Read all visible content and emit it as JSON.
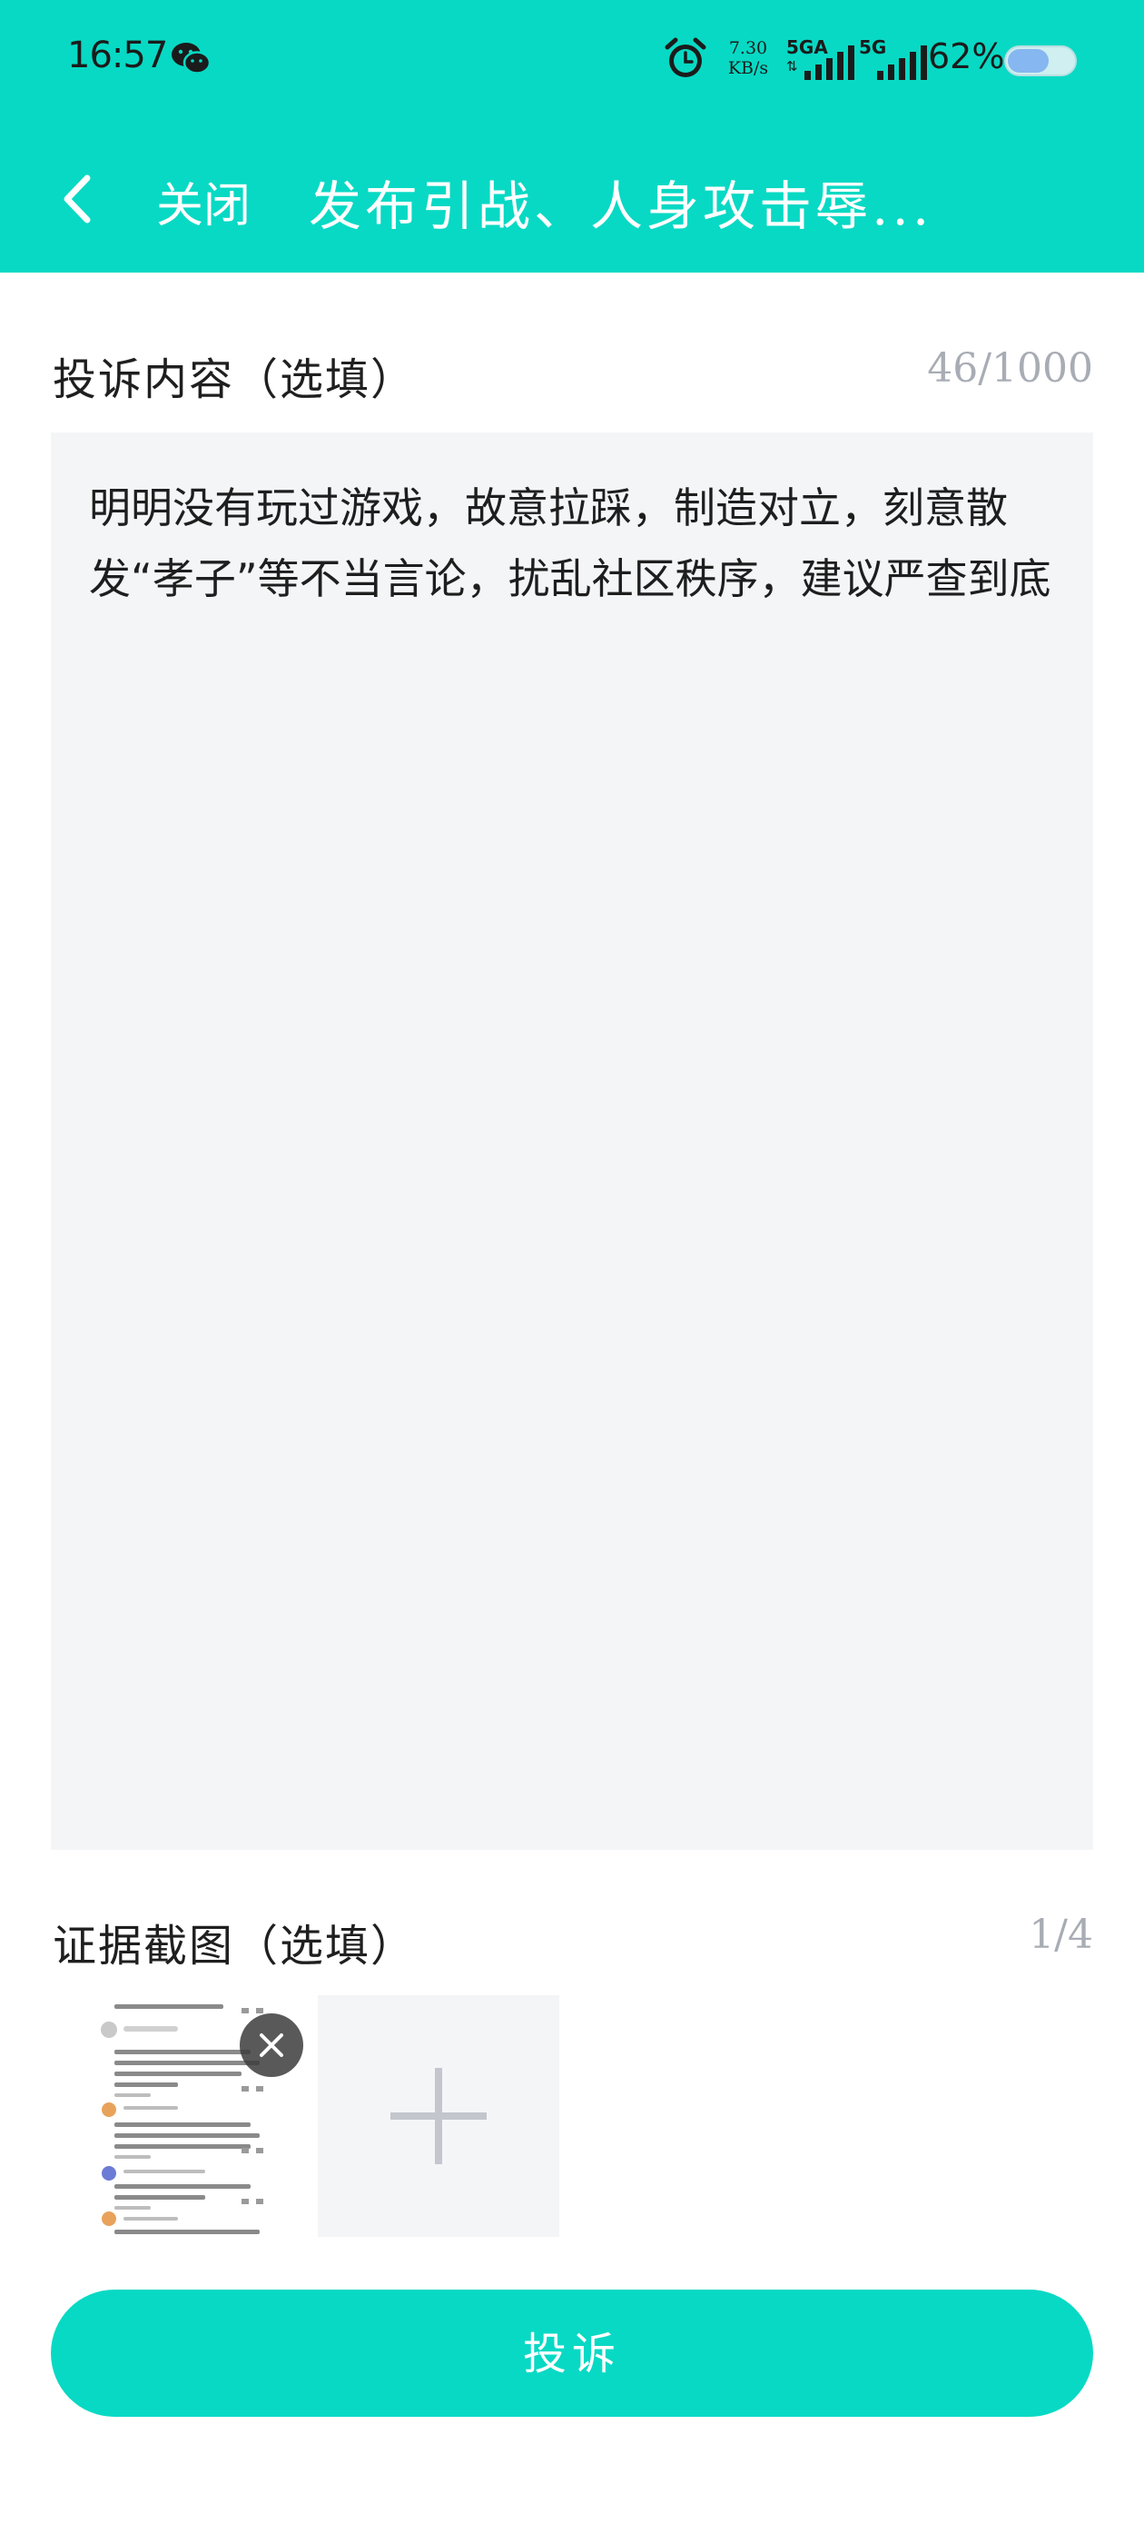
{
  "colors": {
    "accent": "#08d9c4",
    "input_bg": "#f4f5f7",
    "counter_text": "#a8acb4"
  },
  "status_bar": {
    "time": "16:57",
    "net_speed_value": "7.30",
    "net_speed_unit": "KB/s",
    "sim1_label": "5GA",
    "sim2_label": "5G",
    "battery_percent": "62%",
    "battery_level": 0.62
  },
  "nav": {
    "close_label": "关闭",
    "title": "发布引战、人身攻击辱..."
  },
  "complaint": {
    "label": "投诉内容（选填）",
    "counter": "46/1000",
    "text": "明明没有玩过游戏，故意拉踩，制造对立，刻意散发“孝子”等不当言论，扰乱社区秩序，建议严查到底"
  },
  "evidence": {
    "label": "证据截图（选填）",
    "counter": "1/4"
  },
  "submit_label": "投诉"
}
